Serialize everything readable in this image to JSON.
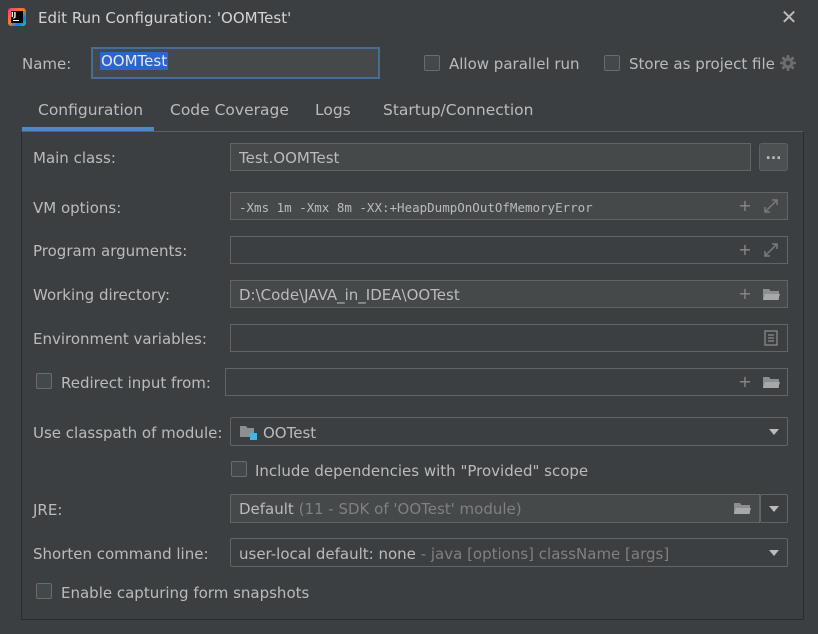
{
  "window": {
    "title": "Edit Run Configuration: 'OOMTest'",
    "icon": "intellij-idea-icon",
    "close_icon": "close-icon"
  },
  "name_row": {
    "label": "Name:",
    "value": "OOMTest",
    "allow_parallel_label": "Allow parallel run",
    "allow_parallel_checked": false,
    "store_project_label": "Store as project file",
    "store_project_checked": false
  },
  "tabs": [
    {
      "label": "Configuration",
      "active": true
    },
    {
      "label": "Code Coverage",
      "active": false
    },
    {
      "label": "Logs",
      "active": false
    },
    {
      "label": "Startup/Connection",
      "active": false
    }
  ],
  "form": {
    "main_class": {
      "label": "Main class:",
      "value": "Test.OOMTest",
      "browse_label": "..."
    },
    "vm_options": {
      "label": "VM options:",
      "value": "-Xms 1m -Xmx 8m -XX:+HeapDumpOnOutOfMemoryError"
    },
    "program_arguments": {
      "label": "Program arguments:",
      "value": ""
    },
    "working_directory": {
      "label": "Working directory:",
      "value": "D:\\Code\\JAVA_in_IDEA\\OOTest"
    },
    "environment_variables": {
      "label": "Environment variables:",
      "value": ""
    },
    "redirect_input": {
      "label": "Redirect input from:",
      "checked": false,
      "value": ""
    },
    "classpath_module": {
      "label": "Use classpath of module:",
      "value": "OOTest"
    },
    "include_dependencies": {
      "label": "Include dependencies with \"Provided\" scope",
      "checked": false
    },
    "jre": {
      "label": "JRE:",
      "value": "Default",
      "hint": "(11 - SDK of 'OOTest' module)"
    },
    "shorten_command_line": {
      "label": "Shorten command line:",
      "value": "user-local default: none",
      "hint": "- java [options] className [args]"
    },
    "enable_snapshots": {
      "label": "Enable capturing form snapshots",
      "checked": false
    }
  },
  "colors": {
    "background": "#3c3f41",
    "field_background": "#45494a",
    "accent": "#4a88c7",
    "selection": "#2f65ca",
    "text": "#bbbbbb"
  }
}
